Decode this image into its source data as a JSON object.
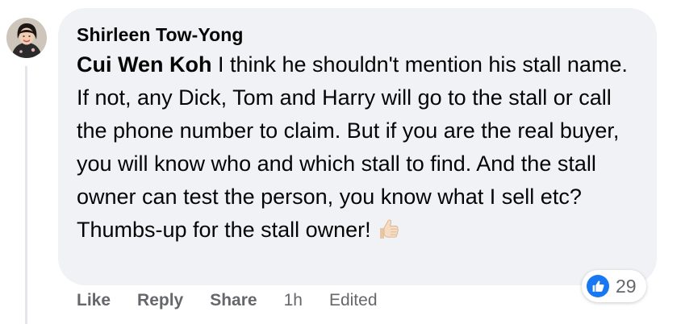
{
  "comment": {
    "author": "Shirleen Tow-Yong",
    "mention": "Cui Wen Koh",
    "text": " I think he shouldn't mention his stall name. If not, any Dick, Tom and Harry will go to the stall or call the phone number to claim. But if you are the real buyer, you will know who and which stall to find. And the stall owner can test the person, you know what I sell etc? Thumbs-up for the stall owner!",
    "emoji_icon": "thumbs-up-light-skin-emoji"
  },
  "reactions": {
    "icon": "like-icon",
    "count": "29",
    "color": "#1877f2"
  },
  "actions": {
    "like": "Like",
    "reply": "Reply",
    "share": "Share",
    "time": "1h",
    "edited": "Edited"
  },
  "colors": {
    "bubble": "#f0f2f5",
    "secondary_text": "#65676b",
    "primary_text": "#050505"
  }
}
